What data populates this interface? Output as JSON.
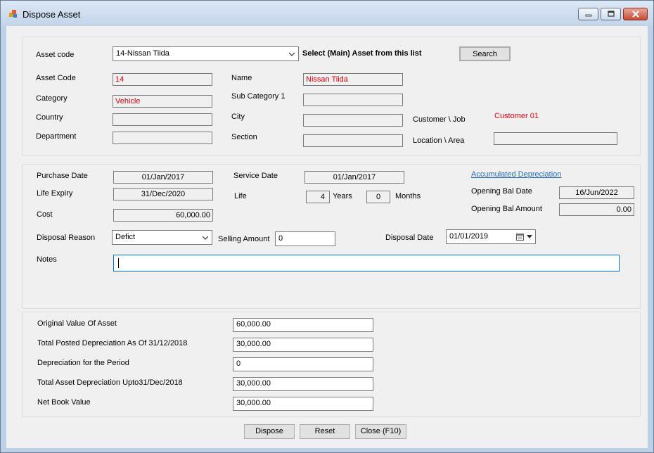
{
  "window": {
    "title": "Dispose Asset"
  },
  "asset_select": {
    "label": "Asset code",
    "value": "14-Nissan Tiida",
    "hint": "Select (Main) Asset from this list",
    "search_label": "Search"
  },
  "details": {
    "asset_code_label": "Asset Code",
    "asset_code": "14",
    "name_label": "Name",
    "name": "Nissan Tiida",
    "category_label": "Category",
    "category": "Vehicle",
    "sub_category_label": "Sub Category 1",
    "sub_category": "",
    "country_label": "Country",
    "country": "",
    "city_label": "City",
    "city": "",
    "customer_label": "Customer \\ Job",
    "customer": "Customer 01",
    "department_label": "Department",
    "department": "",
    "section_label": "Section",
    "section": "",
    "location_label": "Location \\ Area",
    "location": ""
  },
  "dates": {
    "purchase_date_label": "Purchase Date",
    "purchase_date": "01/Jan/2017",
    "service_date_label": "Service Date",
    "service_date": "01/Jan/2017",
    "accum_dep_link": "Accumulated Depreciation",
    "life_expiry_label": "Life Expiry",
    "life_expiry": "31/Dec/2020",
    "life_label": "Life",
    "life_years": "4",
    "years_label": "Years",
    "life_months": "0",
    "months_label": "Months",
    "opening_bal_date_label": "Opening Bal Date",
    "opening_bal_date": "16/Jun/2022",
    "cost_label": "Cost",
    "cost": "60,000.00",
    "opening_bal_amount_label": "Opening Bal Amount",
    "opening_bal_amount": "0.00",
    "disposal_reason_label": "Disposal Reason",
    "disposal_reason": "Defict",
    "selling_amount_label": "Selling Amount",
    "selling_amount": "0",
    "disposal_date_label": "Disposal Date",
    "disposal_date": "01/01/2019",
    "notes_label": "Notes",
    "notes": ""
  },
  "summary": {
    "original_value_label": "Original Value Of Asset",
    "original_value": "60,000.00",
    "total_posted_label": "Total Posted Depreciation As Of 31/12/2018",
    "total_posted": "30,000.00",
    "dep_period_label": "Depreciation for the Period",
    "dep_period": "0",
    "total_asset_dep_label": "Total Asset Depreciation Upto31/Dec/2018",
    "total_asset_dep": "30,000.00",
    "net_book_value_label": "Net Book Value",
    "net_book_value": "30,000.00"
  },
  "buttons": {
    "dispose": "Dispose",
    "reset": "Reset",
    "close": "Close (F10)"
  }
}
